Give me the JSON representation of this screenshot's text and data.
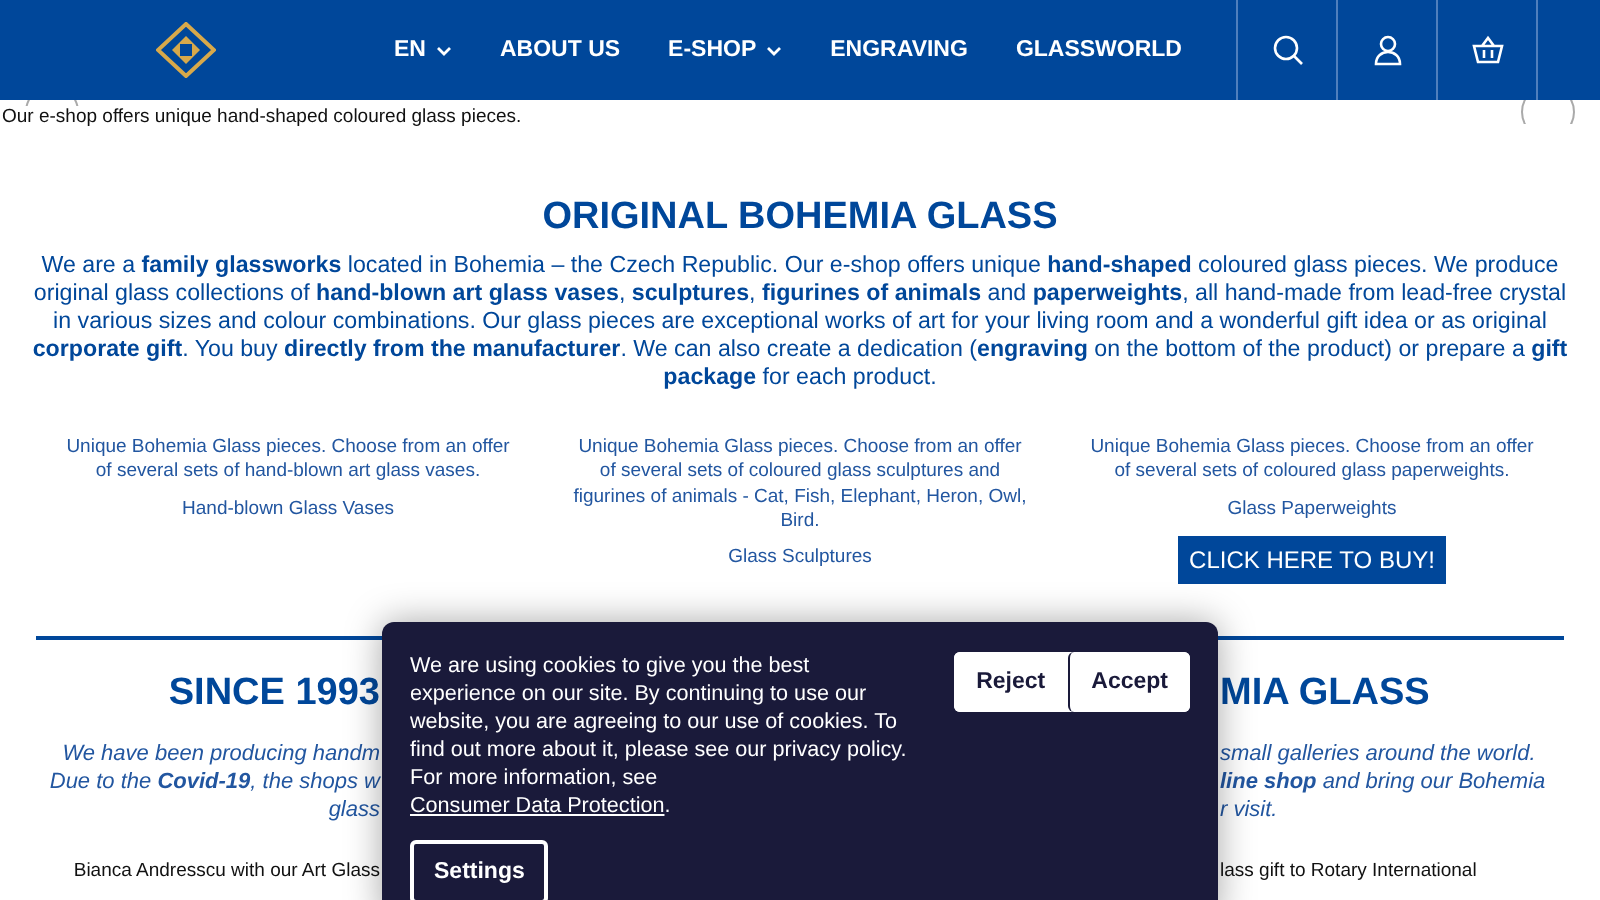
{
  "header": {
    "nav": [
      {
        "label": "EN",
        "dropdown": true
      },
      {
        "label": "ABOUT US",
        "dropdown": false
      },
      {
        "label": "E-SHOP",
        "dropdown": true
      },
      {
        "label": "ENGRAVING",
        "dropdown": false
      },
      {
        "label": "GLASSWORLD",
        "dropdown": false
      }
    ]
  },
  "tagline": "Our e-shop offers unique hand-shaped coloured glass pieces.",
  "intro": {
    "title": "ORIGINAL BOHEMIA GLASS",
    "text": "We are a **family glassworks** located in Bohemia – the Czech Republic. Our e-shop offers unique **hand-shaped** coloured glass pieces. We produce original glass collections of **hand-blown art glass vases**, **sculptures**, **figurines of animals** and **paperweights**, all hand-made from lead-free crystal in various sizes and colour combinations. Our glass pieces are exceptional works of art for your living room and a wonderful gift idea or as original **corporate gift**. You buy **directly from the manufacturer**. We can also create a dedication (**engraving** on the bottom of the product) or prepare a **gift package** for each product."
  },
  "categories": [
    {
      "description": "Unique Bohemia Glass pieces. Choose from an offer of several sets of hand-blown art glass vases.",
      "link": "Hand-blown Glass Vases"
    },
    {
      "description": "Unique Bohemia Glass pieces. Choose from an offer of several sets of coloured glass sculptures and figurines of animals - Cat, Fish, Elephant, Heron, Owl, Bird.",
      "link": "Glass Sculptures"
    },
    {
      "description": "Unique Bohemia Glass pieces. Choose from an offer of several sets of coloured glass paperweights.",
      "link": "Glass Paperweights",
      "button": "CLICK HERE TO BUY!"
    }
  ],
  "history": {
    "left": {
      "title": "SINCE 1993",
      "lines": [
        "We have been producing handm",
        "Due to the **Covid-19**, the shops w",
        "glass"
      ],
      "caption": "Bianca Andresscu with our Art Glass"
    },
    "right": {
      "title": "MIA GLASS",
      "lines": [
        "small galleries around the world.",
        "**line shop** and bring our Bohemia",
        "r visit."
      ],
      "caption": "lass gift to Rotary International"
    }
  },
  "cookie_banner": {
    "text": "We are using cookies to give you the best experience on our site. By continuing to use our website, you are agreeing to our use of cookies. To find out more about it, please see our privacy policy. For more information, see ",
    "link": "Consumer Data Protection",
    "end": ".",
    "buttons": [
      "Reject",
      "Accept"
    ],
    "settings": "Settings"
  }
}
